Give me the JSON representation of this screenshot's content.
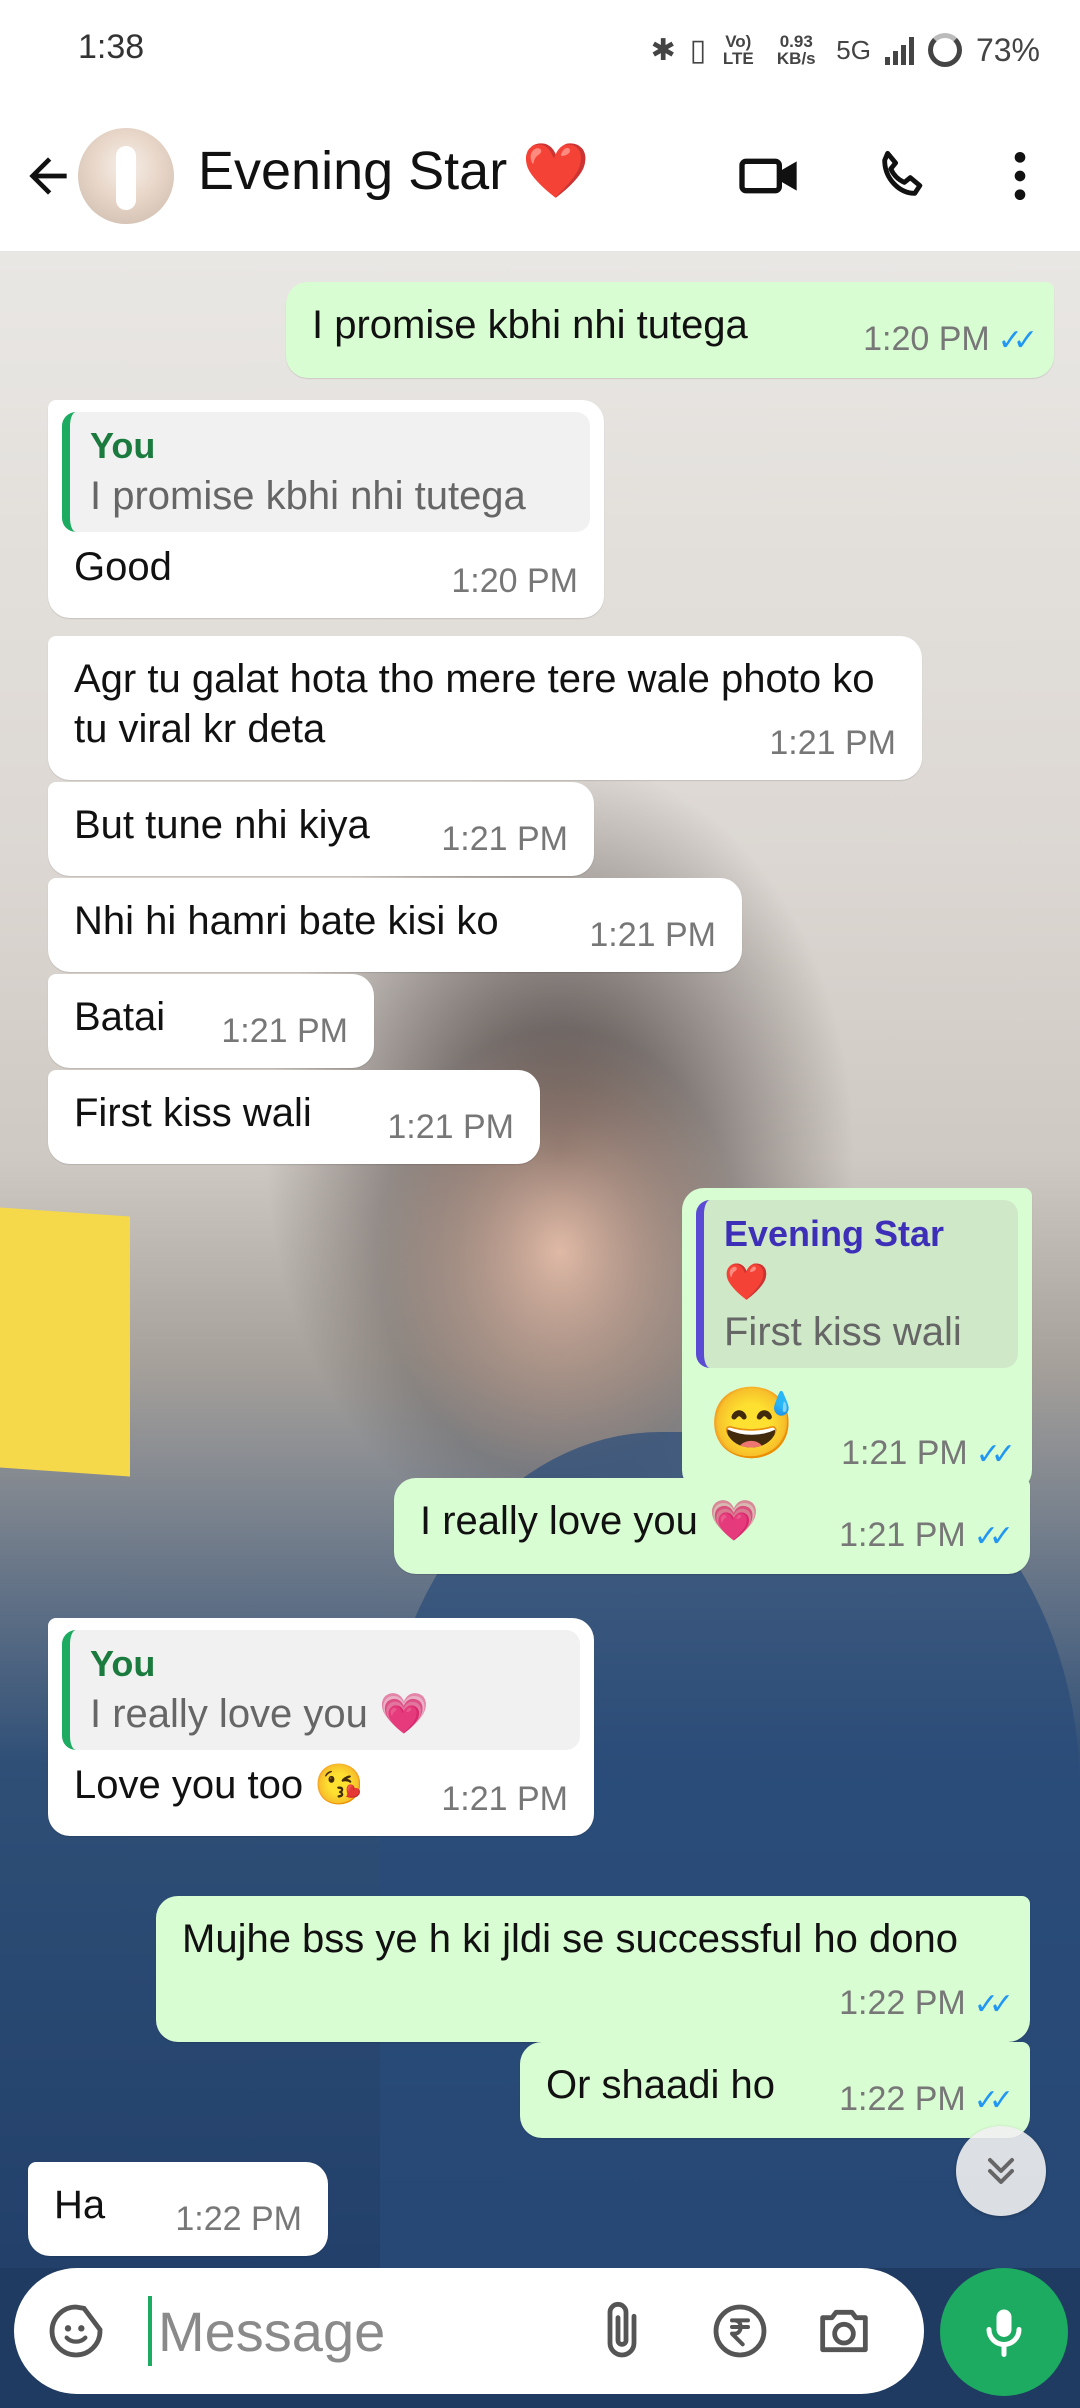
{
  "status_bar": {
    "time": "1:38",
    "network_lte": "Vo) LTE",
    "net_speed": "0.93 KB/s",
    "network_type": "5G",
    "battery": "73%"
  },
  "header": {
    "contact_name": "Evening Star",
    "heart": "❤️"
  },
  "messages": [
    {
      "dir": "out",
      "text": "I promise kbhi nhi tutega",
      "time": "1:20 PM",
      "ticks": "✓✓"
    },
    {
      "dir": "in",
      "quote_name": "You",
      "quote_text": "I promise kbhi nhi tutega",
      "text": "Good",
      "time": "1:20 PM"
    },
    {
      "dir": "in",
      "text": "Agr tu galat hota tho mere tere wale photo ko tu viral kr deta",
      "time": "1:21 PM"
    },
    {
      "dir": "in",
      "text": "But tune nhi kiya",
      "time": "1:21 PM"
    },
    {
      "dir": "in",
      "text": "Nhi hi hamri bate kisi ko",
      "time": "1:21 PM"
    },
    {
      "dir": "in",
      "text": "Batai",
      "time": "1:21 PM"
    },
    {
      "dir": "in",
      "text": "First kiss wali",
      "time": "1:21 PM"
    },
    {
      "dir": "out",
      "quote_name": "Evening Star ❤️",
      "quote_text": "First kiss wali",
      "text": "😅",
      "time": "1:21 PM",
      "ticks": "✓✓"
    },
    {
      "dir": "out",
      "text": "I really love you 💗",
      "time": "1:21 PM",
      "ticks": "✓✓"
    },
    {
      "dir": "in",
      "quote_name": "You",
      "quote_text": "I really love you 💗",
      "text": "Love you too 😘",
      "time": "1:21 PM"
    },
    {
      "dir": "out",
      "text": "Mujhe bss ye h ki jldi se successful ho dono",
      "time": "1:22 PM",
      "ticks": "✓✓"
    },
    {
      "dir": "out",
      "text": "Or shaadi ho",
      "time": "1:22 PM",
      "ticks": "✓✓"
    },
    {
      "dir": "in",
      "text": "Ha",
      "time": "1:22 PM"
    }
  ],
  "composer": {
    "placeholder": "Message"
  },
  "icons": {
    "back": "arrow-left",
    "video": "video-camera",
    "call": "phone",
    "menu": "more-vertical",
    "emoji": "sticker-smile",
    "attach": "paperclip",
    "payment": "rupee",
    "camera": "camera",
    "mic": "microphone",
    "scroll": "double-chevron-down"
  },
  "colors": {
    "accent": "#1daa61",
    "outgoing_bubble": "#d9fdd3",
    "read_ticks": "#2196f3"
  }
}
